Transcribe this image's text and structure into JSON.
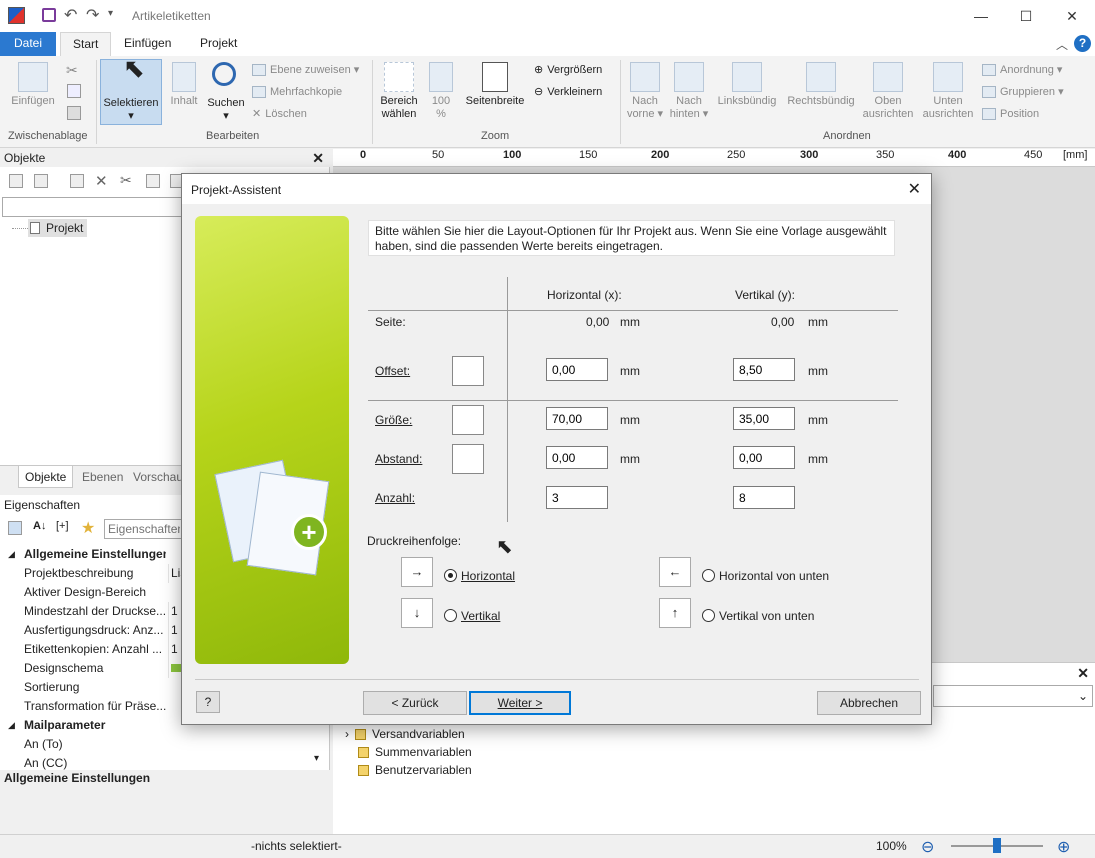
{
  "window": {
    "title": "Artikeletiketten"
  },
  "ribbon_tabs": [
    "Datei",
    "Start",
    "Einfügen",
    "Projekt"
  ],
  "ribbon": {
    "einfuegen": "Einfügen",
    "zwischenablage": "Zwischenablage",
    "selektieren": "Selektieren",
    "inhalt": "Inhalt",
    "suchen": "Suchen",
    "ebene_zuweisen": "Ebene zuweisen",
    "mehrfachkopie": "Mehrfachkopie",
    "loeschen": "Löschen",
    "bearbeiten": "Bearbeiten",
    "bereich_waehlen": "Bereich\nwählen",
    "bereich_l1": "Bereich",
    "bereich_l2": "wählen",
    "zoom100_l1": "100",
    "zoom100_l2": "%",
    "seitenbreite": "Seitenbreite",
    "vergroessern": "Vergrößern",
    "verkleinern": "Verkleinern",
    "zoom": "Zoom",
    "nach_vorne_l1": "Nach",
    "nach_vorne_l2": "vorne",
    "nach_hinten_l1": "Nach",
    "nach_hinten_l2": "hinten",
    "linksbuendig": "Linksbündig",
    "rechtsbuendig": "Rechtsbündig",
    "oben_l1": "Oben",
    "oben_l2": "ausrichten",
    "unten_l1": "Unten",
    "unten_l2": "ausrichten",
    "anordnung": "Anordnung",
    "gruppieren": "Gruppieren",
    "position": "Position",
    "anordnen": "Anordnen"
  },
  "objects_panel": {
    "title": "Objekte",
    "tree_item": "Projekt"
  },
  "lower_tabs": [
    "Objekte",
    "Ebenen",
    "Vorschau"
  ],
  "properties": {
    "title": "Eigenschaften",
    "search_placeholder": "Eigenschaften",
    "rows": [
      {
        "key": "Allgemeine Einstellungen",
        "value": "",
        "cat": true
      },
      {
        "key": "Projektbeschreibung",
        "value": "Lis"
      },
      {
        "key": "Aktiver Design-Bereich",
        "value": ""
      },
      {
        "key": "Mindestzahl der Druckse...",
        "value": "1"
      },
      {
        "key": "Ausfertigungsdruck: Anz...",
        "value": "1"
      },
      {
        "key": "Etikettenkopien: Anzahl ...",
        "value": "1"
      },
      {
        "key": "Designschema",
        "value": ""
      },
      {
        "key": "Sortierung",
        "value": ""
      },
      {
        "key": "Transformation für Präse...",
        "value": ""
      },
      {
        "key": "Mailparameter",
        "value": "",
        "cat": true
      },
      {
        "key": "An (To)",
        "value": ""
      },
      {
        "key": "An (CC)",
        "value": ""
      }
    ],
    "footer": "Allgemeine Einstellungen"
  },
  "ruler": {
    "labels": [
      "0",
      "50",
      "100",
      "150",
      "200",
      "250",
      "300",
      "350",
      "400",
      "450"
    ],
    "unit": "[mm]"
  },
  "variables": [
    "Versandvariablen",
    "Summenvariablen",
    "Benutzervariablen"
  ],
  "status": {
    "selection": "-nichts selektiert-",
    "zoom": "100%"
  },
  "dialog": {
    "title": "Projekt-Assistent",
    "intro": "Bitte wählen Sie hier die Layout-Optionen für Ihr Projekt aus. Wenn Sie eine Vorlage ausgewählt haben, sind die passenden Werte bereits eingetragen.",
    "col_h": "Horizontal (x):",
    "col_v": "Vertikal (y):",
    "unit": "mm",
    "seite": {
      "label": "Seite:",
      "x": "0,00",
      "y": "0,00"
    },
    "offset": {
      "label": "Offset:",
      "x": "0,00",
      "y": "8,50"
    },
    "groesse": {
      "label": "Größe:",
      "x": "70,00",
      "y": "35,00"
    },
    "abstand": {
      "label": "Abstand:",
      "x": "0,00",
      "y": "0,00"
    },
    "anzahl": {
      "label": "Anzahl:",
      "x": "3",
      "y": "8"
    },
    "druck_label": "Druckreihenfolge:",
    "opt_horizontal": "Horizontal",
    "opt_vertikal": "Vertikal",
    "opt_horizontal_unten": "Horizontal von unten",
    "opt_vertikal_unten": "Vertikal von unten",
    "btn_help": "?",
    "btn_back": "< Zurück",
    "btn_next": "Weiter >",
    "btn_cancel": "Abbrechen"
  }
}
